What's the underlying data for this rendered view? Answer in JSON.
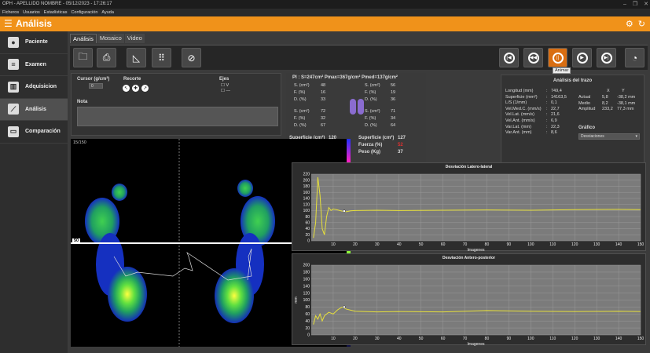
{
  "window": {
    "title": "OPH - APELLIDO NOMBRE - 05/12/2023 - 17:26:17",
    "controls": [
      "–",
      "❐",
      "✕"
    ]
  },
  "menu": [
    "Ficheros",
    "Usuarios",
    "Estadísticas",
    "Configuración",
    "Ayuda"
  ],
  "header": {
    "title": "Análisis",
    "accent": "#f0921a"
  },
  "sidebar": {
    "items": [
      {
        "label": "Paciente",
        "icon": "person-icon"
      },
      {
        "label": "Examen",
        "icon": "clipboard-icon"
      },
      {
        "label": "Adquisicion",
        "icon": "acquisition-icon"
      },
      {
        "label": "Análisis",
        "icon": "chart-icon",
        "active": true
      },
      {
        "label": "Comparación",
        "icon": "folder-icon"
      }
    ]
  },
  "tabs": [
    {
      "label": "Análisis",
      "active": true
    },
    {
      "label": "Mosaico"
    },
    {
      "label": "Video"
    }
  ],
  "toolbar": {
    "left_buttons": [
      "open-folder-icon",
      "print-icon",
      "ruler-icon",
      "footprints-icon",
      "no-zoom-icon"
    ],
    "right_buttons": [
      "skip-back-icon",
      "step-back-icon",
      "pause-icon",
      "step-forward-icon",
      "skip-forward-icon",
      "gauge-icon"
    ],
    "tooltip": "Animar"
  },
  "controls": {
    "cursor_label": "Cursor (g/cm²)",
    "cursor_value": "0",
    "recorte_label": "Recorte",
    "ejes_label": "Ejes",
    "ejes_options": [
      "V",
      "—"
    ],
    "nota_label": "Nota",
    "nota_value": ""
  },
  "heatmap": {
    "frame": "15/150",
    "level": "50",
    "colors": [
      "#2030ff",
      "#ff20c0",
      "#ff2020",
      "#ff8800",
      "#ffff00",
      "#80ff40",
      "#20d040",
      "#20a0d0",
      "#2030c0"
    ]
  },
  "pressure": {
    "header": "PI : S=247cm²  Pmax=367g/cm²  Pmed=137g/cm²",
    "left_top": [
      [
        "S. (cm²)",
        "48"
      ],
      [
        "F. (%)",
        "16"
      ],
      [
        "D. (%)",
        "33"
      ]
    ],
    "right_top": [
      [
        "S. (cm²)",
        "56"
      ],
      [
        "F. (%)",
        "19"
      ],
      [
        "D. (%)",
        "36"
      ]
    ],
    "left_bottom": [
      [
        "S. (cm²)",
        "72"
      ],
      [
        "F. (%)",
        "32"
      ],
      [
        "D. (%)",
        "67"
      ]
    ],
    "right_bottom": [
      [
        "S. (cm²)",
        "71"
      ],
      [
        "F. (%)",
        "34"
      ],
      [
        "D. (%)",
        "64"
      ]
    ],
    "left_totals": [
      [
        "Superficie (cm²)",
        "120"
      ],
      [
        "Fuerza (%)",
        "48"
      ],
      [
        "Peso (Kg)",
        "33"
      ]
    ],
    "right_totals": [
      [
        "Superficie (cm²)",
        "127"
      ],
      [
        "Fuerza (%)",
        "52"
      ],
      [
        "Peso (Kg)",
        "37"
      ]
    ]
  },
  "trace": {
    "title": "Análisis del trazo",
    "rows": [
      [
        "Longitud (mm)",
        ":",
        "749,4"
      ],
      [
        "Superficie (mm²)",
        ":",
        "14163,5"
      ],
      [
        "L/S (1/mm)",
        ":",
        "0,1"
      ],
      [
        "Vel.Med.C. (mm/s)",
        ":",
        "22,7"
      ],
      [
        "Vel.Lat. (mm/s)",
        ":",
        "21,6"
      ],
      [
        "Vel.Ant. (mm/s)",
        ":",
        "6,9"
      ],
      [
        "Var.Lat. (mm)",
        ":",
        "22,3"
      ],
      [
        "Var.Ant. (mm)",
        ":",
        "8,6"
      ]
    ],
    "xy_header": [
      "X",
      "Y"
    ],
    "xy_rows": [
      [
        "Actual",
        "5,8",
        "-38,2 mm"
      ],
      [
        "Medio",
        "8,2",
        "-38,1 mm"
      ],
      [
        "Amplitud",
        "233,2",
        "77,3 mm"
      ]
    ],
    "grafico_label": "Gráfico",
    "grafico_value": "Desviaciones"
  },
  "chart_data": [
    {
      "type": "line",
      "title": "Desviación Latero-lateral",
      "xlabel": "Imagenes",
      "ylabel": "",
      "xlim": [
        0,
        150
      ],
      "ylim": [
        0,
        220
      ],
      "xticks": [
        10,
        20,
        30,
        40,
        50,
        60,
        70,
        80,
        90,
        100,
        110,
        120,
        130,
        140,
        150
      ],
      "yticks": [
        0,
        20,
        40,
        60,
        80,
        100,
        120,
        140,
        160,
        180,
        200,
        220
      ],
      "grid": true,
      "x": [
        1,
        2,
        3,
        4,
        5,
        6,
        7,
        8,
        9,
        10,
        12,
        14,
        16,
        18,
        20,
        30,
        40,
        60,
        80,
        100,
        120,
        140,
        150
      ],
      "y": [
        10,
        60,
        210,
        150,
        40,
        20,
        80,
        110,
        100,
        105,
        102,
        98,
        96,
        99,
        100,
        101,
        100,
        101,
        102,
        101,
        103,
        104,
        103
      ],
      "marker_x": 15
    },
    {
      "type": "line",
      "title": "Desviación Antero-posterior",
      "xlabel": "Imagenes",
      "ylabel": "mm",
      "xlim": [
        0,
        150
      ],
      "ylim": [
        0,
        200
      ],
      "xticks": [
        10,
        20,
        30,
        40,
        50,
        60,
        70,
        80,
        90,
        100,
        110,
        120,
        130,
        140,
        150
      ],
      "yticks": [
        0,
        20,
        40,
        60,
        80,
        100,
        120,
        140,
        160,
        180,
        200
      ],
      "grid": true,
      "x": [
        1,
        2,
        3,
        4,
        5,
        6,
        8,
        10,
        12,
        14,
        16,
        20,
        30,
        40,
        60,
        80,
        100,
        120,
        140,
        150
      ],
      "y": [
        30,
        55,
        45,
        60,
        40,
        55,
        65,
        60,
        72,
        80,
        74,
        68,
        66,
        67,
        66,
        70,
        68,
        67,
        68,
        67
      ],
      "marker_x": 15
    }
  ]
}
